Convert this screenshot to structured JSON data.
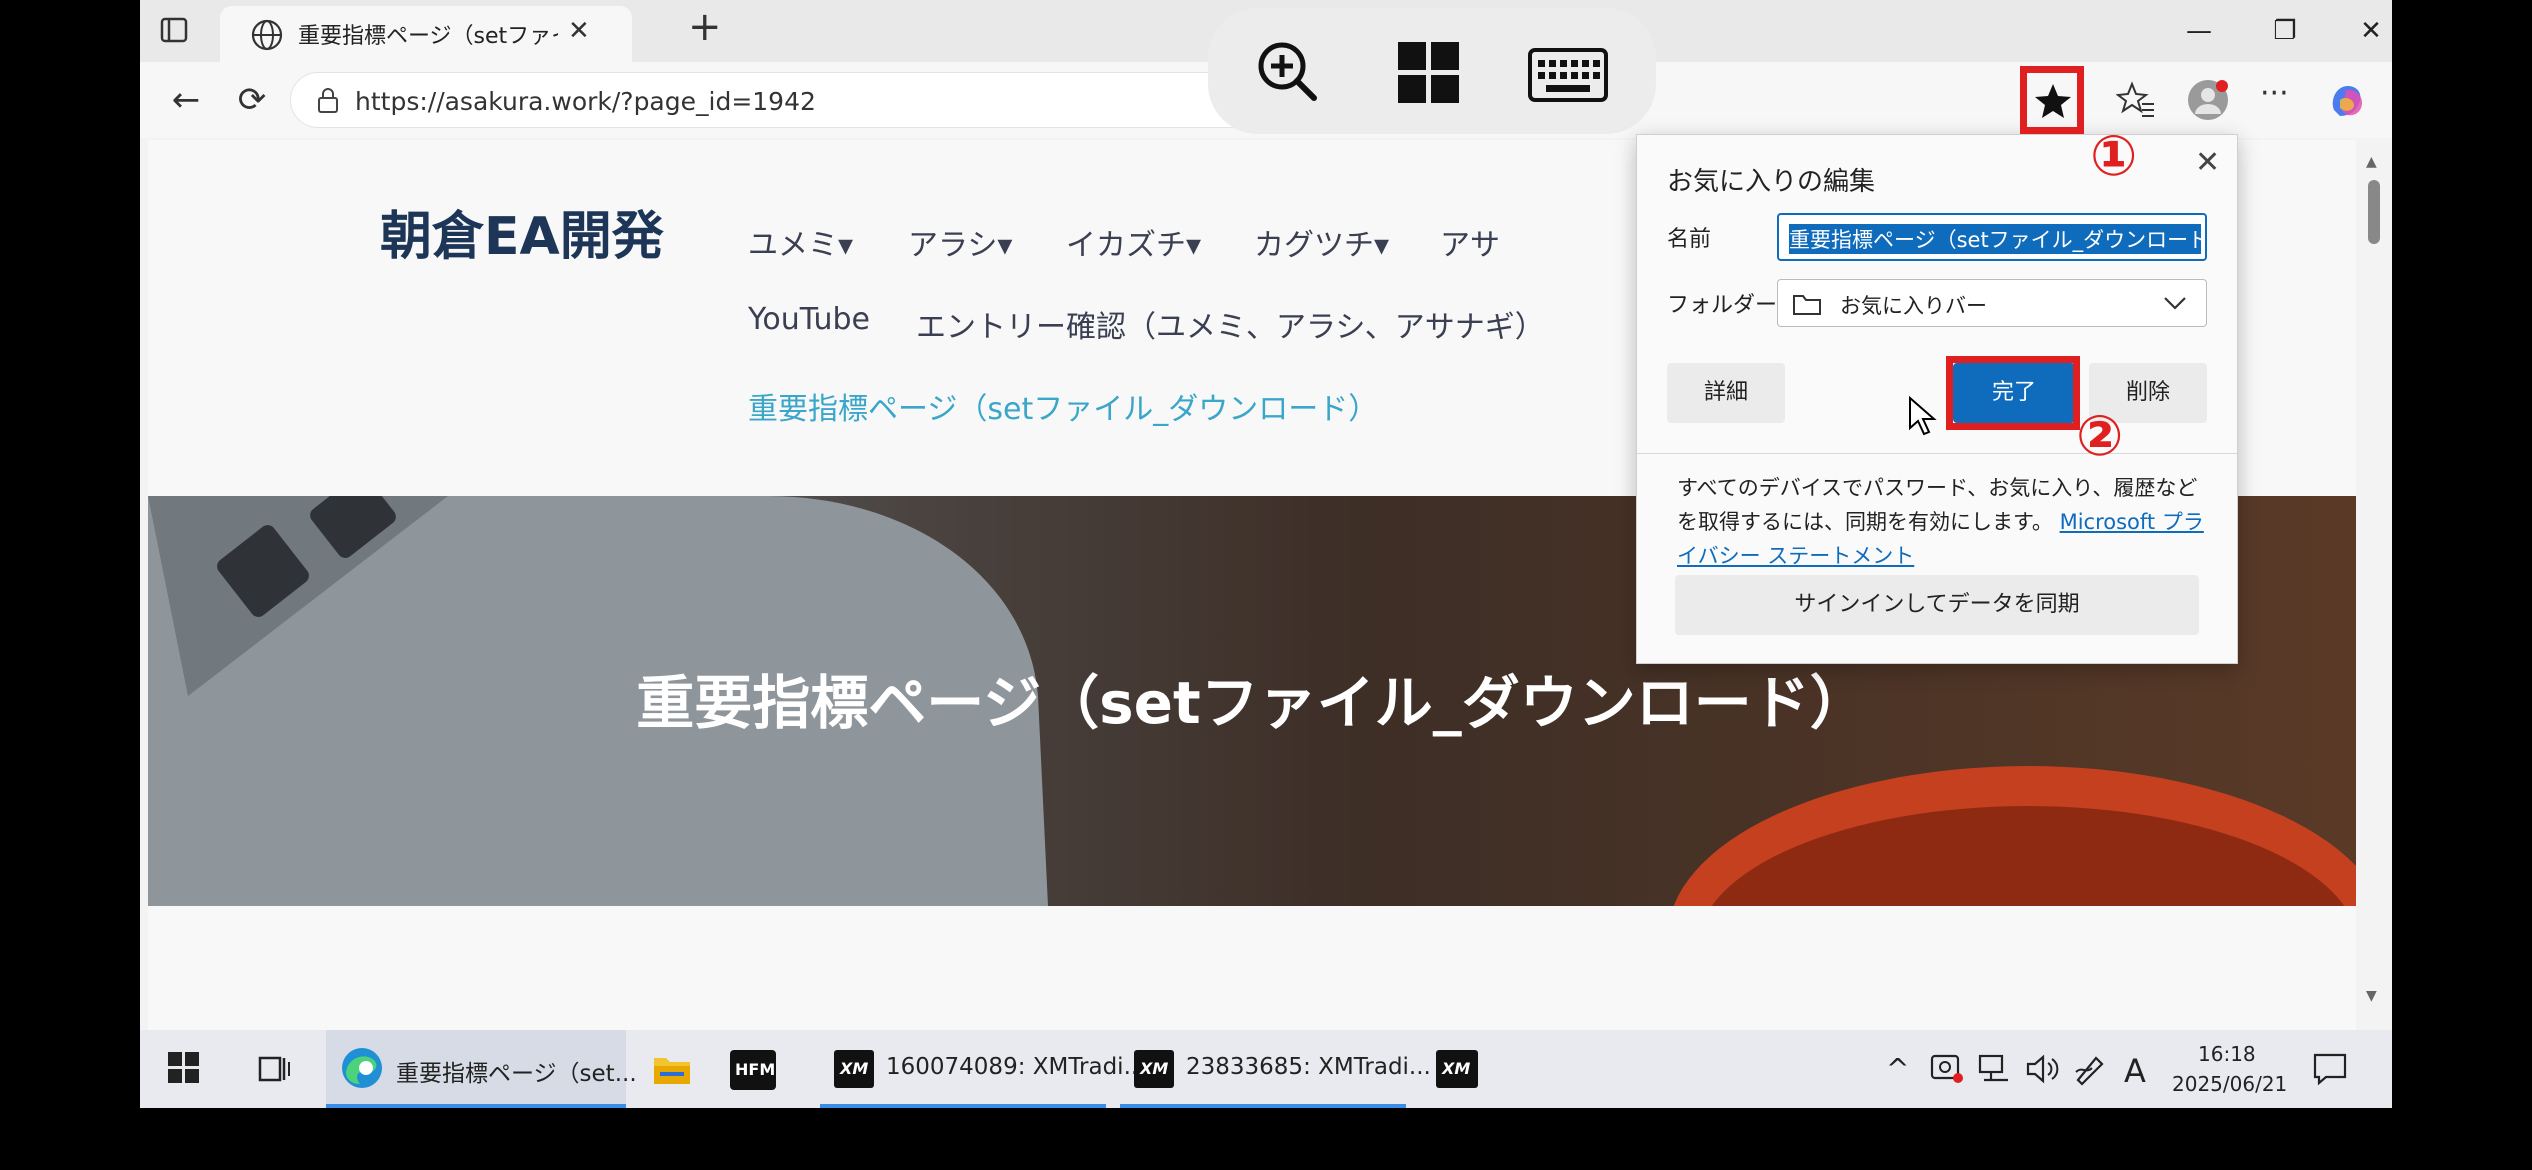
{
  "browser": {
    "tab_title": "重要指標ページ（setファイル_ダウンロード）",
    "url": "https://asakura.work/?page_id=1942",
    "buttons": {
      "back": "←",
      "refresh": "⟳",
      "minimize": "—",
      "restore": "❐",
      "close": "✕",
      "new_tab": "+",
      "tab_close": "✕",
      "more": "···"
    }
  },
  "page": {
    "site_title": "朝倉EA開発",
    "nav": [
      "ユメミ▾",
      "アラシ▾",
      "イカズチ▾",
      "カグツチ▾",
      "アサ"
    ],
    "nav_row2": [
      "YouTube",
      "エントリー確認（ユメミ、アラシ、アサナギ）"
    ],
    "nav_current": "重要指標ページ（setファイル_ダウンロード）",
    "hero_title": "重要指標ページ（setファイル_ダウンロード）"
  },
  "favorites_popup": {
    "title": "お気に入りの編集",
    "name_label": "名前",
    "name_value": "重要指標ページ（setファイル_ダウンロード）-",
    "folder_label": "フォルダー",
    "folder_value": "お気に入りバー",
    "detail_button": "詳細",
    "done_button": "完了",
    "delete_button": "削除",
    "sync_text": "すべてのデバイスでパスワード、お気に入り、履歴などを取得するには、同期を有効にします。",
    "sync_link": "Microsoft プライバシー ステートメント",
    "signin_button": "サインインしてデータを同期",
    "close": "✕"
  },
  "annotations": {
    "step1": "①",
    "step2": "②",
    "color": "#e02020"
  },
  "taskbar": {
    "edge_label": "重要指標ページ（set...",
    "hfm_label": "HFM",
    "xm1_label": "160074089: XMTradi...",
    "xm2_label": "23833685: XMTradi...",
    "xm_logo": "XM",
    "time": "16:18",
    "date": "2025/06/21",
    "ime": "A",
    "tray_chevron": "^"
  }
}
